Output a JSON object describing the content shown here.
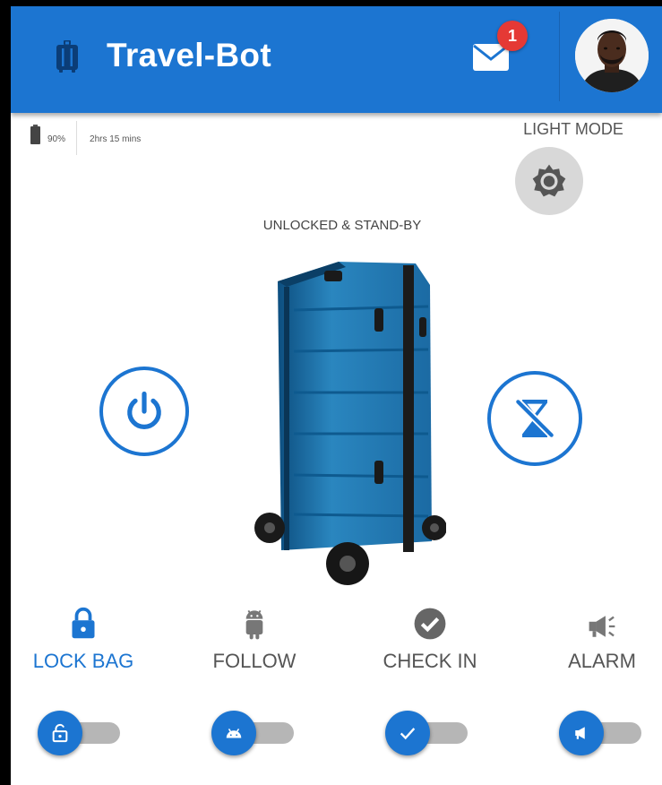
{
  "app": {
    "title": "Travel-Bot",
    "brand_color": "#1c75d1"
  },
  "header": {
    "notifications_count": "1",
    "icons": {
      "bag": "luggage-icon",
      "mail": "mail-icon",
      "profile": "user-avatar"
    }
  },
  "status": {
    "battery_percent": "90%",
    "battery_level": 0.9,
    "time_remaining": "2hrs 15 mins"
  },
  "theme": {
    "label": "LIGHT MODE",
    "icon": "brightness-icon"
  },
  "device": {
    "state_label": "UNLOCKED & STAND-BY",
    "image": "blue-suitcase-robot"
  },
  "controls": {
    "power": {
      "icon": "power-icon"
    },
    "timer": {
      "icon": "hourglass-disabled-icon"
    }
  },
  "features": [
    {
      "label": "LOCK BAG",
      "icon": "lock-icon",
      "active": true,
      "switch_icon": "unlock-icon",
      "enabled": false
    },
    {
      "label": "FOLLOW",
      "icon": "android-icon",
      "active": false,
      "switch_icon": "android-icon",
      "enabled": false
    },
    {
      "label": "CHECK IN",
      "icon": "check-circle-icon",
      "active": false,
      "switch_icon": "check-icon",
      "enabled": false
    },
    {
      "label": "ALARM",
      "icon": "megaphone-icon",
      "active": false,
      "switch_icon": "megaphone-icon",
      "enabled": false
    }
  ]
}
